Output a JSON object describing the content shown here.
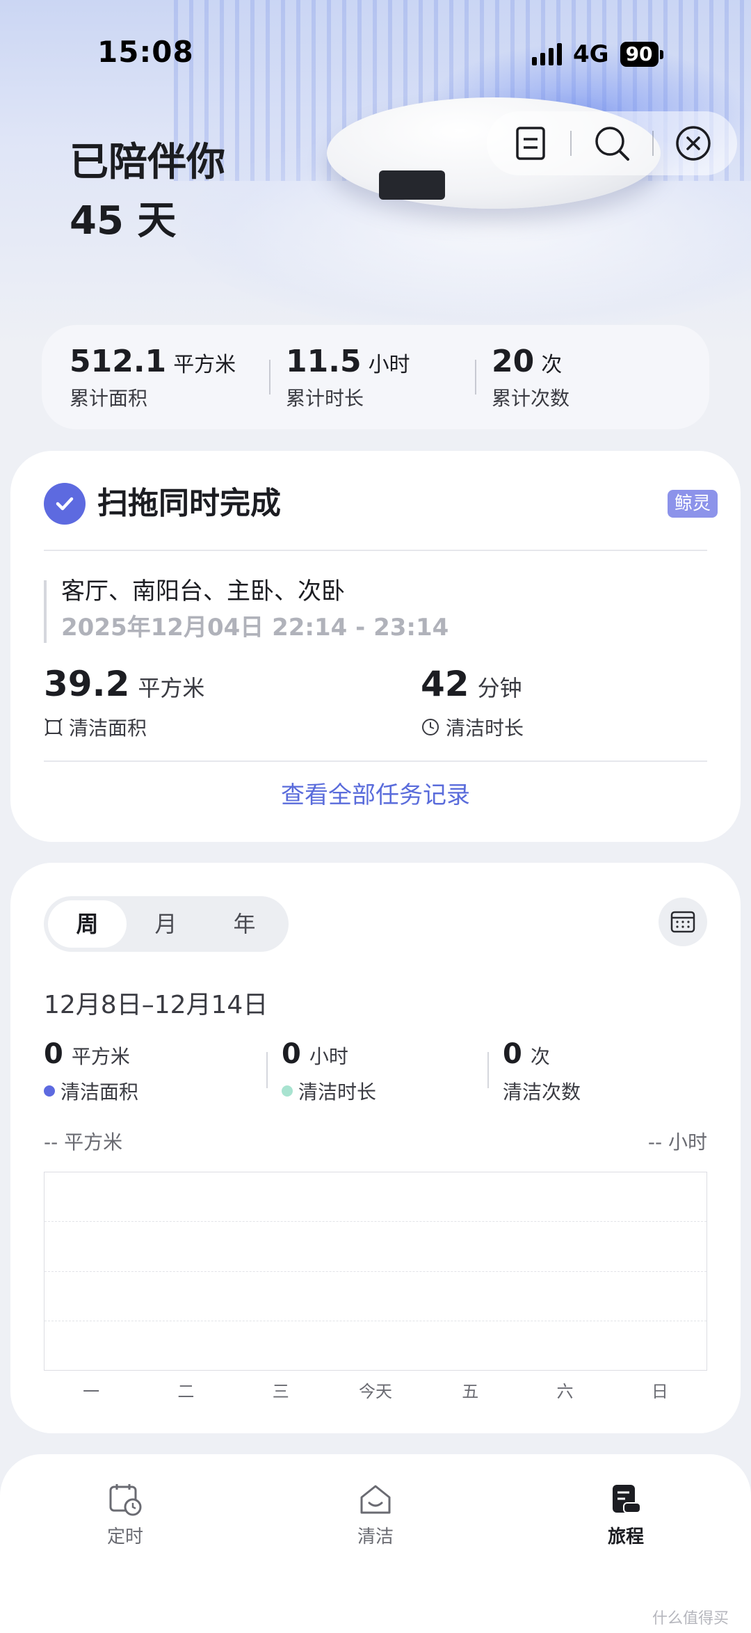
{
  "status_bar": {
    "time": "15:08",
    "network": "4G",
    "battery": "90"
  },
  "hero": {
    "title_line1": "已陪伴你",
    "title_line2": "45 天"
  },
  "top_actions": {
    "icons": [
      "document-icon",
      "search-icon",
      "close-icon"
    ]
  },
  "summary": {
    "area": {
      "value": "512.1",
      "unit": "平方米",
      "label": "累计面积"
    },
    "duration": {
      "value": "11.5",
      "unit": "小时",
      "label": "累计时长"
    },
    "count": {
      "value": "20",
      "unit": "次",
      "label": "累计次数"
    }
  },
  "last_task": {
    "title": "扫拖同时完成",
    "tag": "鲸灵",
    "rooms": "客厅、南阳台、主卧、次卧",
    "time_range": "2025年12月04日 22:14 - 23:14",
    "area": {
      "value": "39.2",
      "unit": "平方米",
      "label": "清洁面积"
    },
    "duration": {
      "value": "42",
      "unit": "分钟",
      "label": "清洁时长"
    },
    "view_all": "查看全部任务记录"
  },
  "stats": {
    "tabs": [
      "周",
      "月",
      "年"
    ],
    "active_tab": "周",
    "range": "12月8日–12月14日",
    "area": {
      "value": "0",
      "unit": "平方米",
      "label": "清洁面积"
    },
    "duration": {
      "value": "0",
      "unit": "小时",
      "label": "清洁时长"
    },
    "count": {
      "value": "0",
      "unit": "次",
      "label": "清洁次数"
    },
    "left_axis_unit": "-- 平方米",
    "right_axis_unit": "-- 小时",
    "colors": {
      "area": "#5d6ae0",
      "duration": "#a8e3d0"
    }
  },
  "chart_data": {
    "type": "bar",
    "categories": [
      "一",
      "二",
      "三",
      "今天",
      "五",
      "六",
      "日"
    ],
    "series": [
      {
        "name": "清洁面积",
        "values": [
          0,
          0,
          0,
          0,
          0,
          0,
          0
        ]
      },
      {
        "name": "清洁时长",
        "values": [
          0,
          0,
          0,
          0,
          0,
          0,
          0
        ]
      }
    ],
    "ylabel": "-- 平方米",
    "y2label": "-- 小时",
    "grid": true
  },
  "bottom_nav": {
    "items": [
      {
        "label": "定时",
        "icon": "calendar-clock-icon"
      },
      {
        "label": "清洁",
        "icon": "home-clean-icon"
      },
      {
        "label": "旅程",
        "icon": "journey-icon"
      }
    ],
    "active": "旅程"
  },
  "watermark": "什么值得买"
}
